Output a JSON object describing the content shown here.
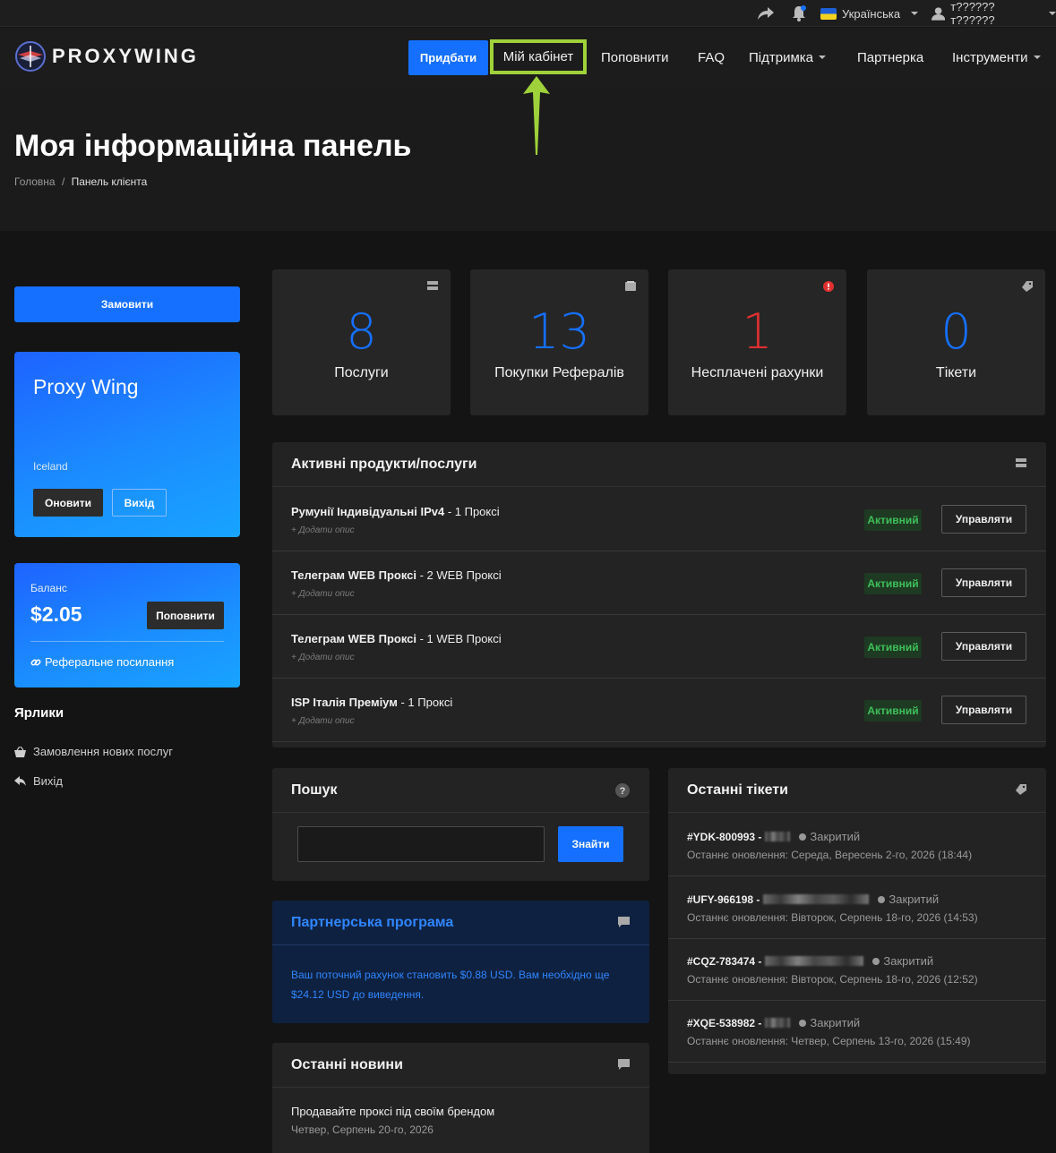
{
  "topbar": {
    "language": "Українська",
    "user": "т?????? т??????"
  },
  "header": {
    "logo_text": "PROXYWING",
    "buy_label": "Придбати",
    "nav": [
      "Мій кабінет",
      "Поповнити",
      "FAQ",
      "Підтримка",
      "Партнерка",
      "Інструменти"
    ]
  },
  "page": {
    "title": "Моя інформаційна панель",
    "breadcrumb_home": "Головна",
    "breadcrumb_sep": "/",
    "breadcrumb_current": "Панель клієнта"
  },
  "sidebar": {
    "order_label": "Замовити",
    "profile_name": "Proxy Wing",
    "profile_country": "Iceland",
    "update_label": "Оновити",
    "logout_label": "Вихід",
    "balance_label": "Баланс",
    "balance_amount": "$2.05",
    "topup_label": "Поповнити",
    "referral_label": "Реферальне посилання",
    "shortcuts_title": "Ярлики",
    "shortcuts": [
      "Замовлення нових послуг",
      "Вихід"
    ]
  },
  "stats": [
    {
      "value": "8",
      "label": "Послуги",
      "color": "#1570ff"
    },
    {
      "value": "13",
      "label": "Покупки Рефералів",
      "color": "#1570ff"
    },
    {
      "value": "1",
      "label": "Несплачені рахунки",
      "color": "#e03030"
    },
    {
      "value": "0",
      "label": "Тікети",
      "color": "#1570ff"
    }
  ],
  "services": {
    "title": "Активні продукти/послуги",
    "add_desc": "+ Додати опис",
    "status_label": "Активний",
    "manage_label": "Управляти",
    "items": [
      {
        "name": "Румунії Індивідуальні IPv4",
        "suffix": " - 1 Проксі"
      },
      {
        "name": "Телеграм WEB Проксі",
        "suffix": " - 2 WEB Проксі"
      },
      {
        "name": "Телеграм WEB Проксі",
        "suffix": " - 1 WEB Проксі"
      },
      {
        "name": "ISP Італія Преміум",
        "suffix": " - 1 Проксі"
      }
    ]
  },
  "search": {
    "title": "Пошук",
    "button": "Знайти",
    "value": ""
  },
  "partner": {
    "title": "Партнерська програма",
    "text": "Ваш поточний рахунок становить $0.88 USD. Вам необхідно ще $24.12 USD до виведення."
  },
  "news": {
    "title": "Останні новини",
    "items": [
      {
        "title": "Продавайте проксі під своїм брендом",
        "date": "Четвер, Серпень 20-го, 2026"
      }
    ]
  },
  "tickets": {
    "title": "Останні тікети",
    "items": [
      {
        "id": "#YDK-800993 -",
        "status": "Закритий",
        "updated": "Останнє оновлення: Середа, Вересень 2-го, 2026 (18:44)"
      },
      {
        "id": "#UFY-966198 -",
        "status": "Закритий",
        "updated": "Останнє оновлення: Вівторок, Серпень 18-го, 2026 (14:53)"
      },
      {
        "id": "#CQZ-783474 -",
        "status": "Закритий",
        "updated": "Останнє оновлення: Вівторок, Серпень 18-го, 2026 (12:52)"
      },
      {
        "id": "#XQE-538982 -",
        "status": "Закритий",
        "updated": "Останнє оновлення: Четвер, Серпень 13-го, 2026 (15:49)"
      }
    ]
  },
  "colors": {
    "accent": "#1570ff",
    "highlight": "#9fd23a",
    "active_green": "#3fbf5a"
  }
}
